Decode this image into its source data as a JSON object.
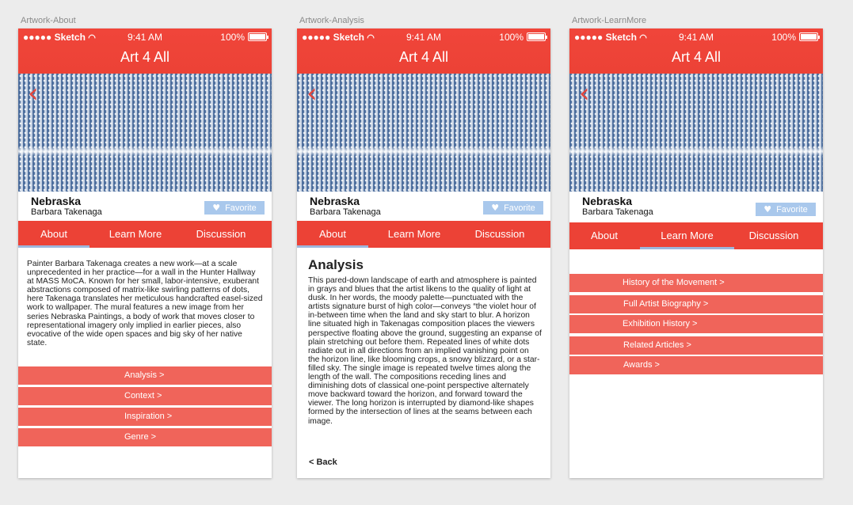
{
  "artboards": [
    {
      "label": "Artwork-About"
    },
    {
      "label": "Artwork-Analysis"
    },
    {
      "label": "Artwork-LearnMore"
    }
  ],
  "status_bar": {
    "carrier": "●●●●● Sketch",
    "wifi_icon": "wifi-icon",
    "time": "9:41 AM",
    "battery": "100%"
  },
  "app": {
    "title": "Art 4 All"
  },
  "artwork": {
    "title": "Nebraska",
    "artist": "Barbara Takenaga",
    "favorite_label": "Favorite"
  },
  "tabs": [
    "About",
    "Learn More",
    "Discussion"
  ],
  "about": {
    "text": "Painter Barbara Takenaga creates a new work—at a scale unprecedented in her practice—for a wall in the Hunter Hallway at MASS MoCA. Known for her small, labor-intensive, exuberant abstractions composed of matrix-like swirling patterns of dots, here Takenaga translates her meticulous handcrafted easel-sized work to wallpaper. The mural features a new image from her series Nebraska Paintings, a body of work that moves closer to representational imagery only implied in earlier pieces, also evocative of the wide open spaces and big sky of her native state.",
    "links": [
      "Analysis >",
      "Context >",
      "Inspiration >",
      "Genre >"
    ]
  },
  "analysis": {
    "heading": "Analysis",
    "text": "This pared-down landscape of earth and atmosphere is painted in grays and blues that the artist likens to the quality of light at dusk. In her words, the moody palette—punctuated with the artists signature burst of high color—conveys  “the violet hour of in-between time when the land and sky start to blur. A horizon line situated high in Takenagas composition places the viewers perspective floating above the ground, suggesting an expanse of plain stretching out before them. Repeated lines of white dots radiate out in all directions from an implied vanishing point on the horizon line, like blooming crops, a snowy blizzard, or a star-filled sky. The single image is repeated twelve times along the length of the wall. The compositions receding lines and diminishing dots of classical one-point perspective alternately move backward toward the horizon, and forward toward the viewer. The long horizon is interrupted by diamond-like shapes formed by the intersection of lines at the seams between each image.",
    "back_label": "< Back"
  },
  "learn_more": {
    "links": [
      "History of the Movement >",
      "Full Artist Biography >",
      "Exhibition History >",
      "Related Articles >",
      "Awards >"
    ]
  },
  "colors": {
    "header": "#ec4236",
    "list_button": "#f0645a",
    "favorite": "#a9c8ec",
    "tab_indicator": "#9db6dc"
  }
}
